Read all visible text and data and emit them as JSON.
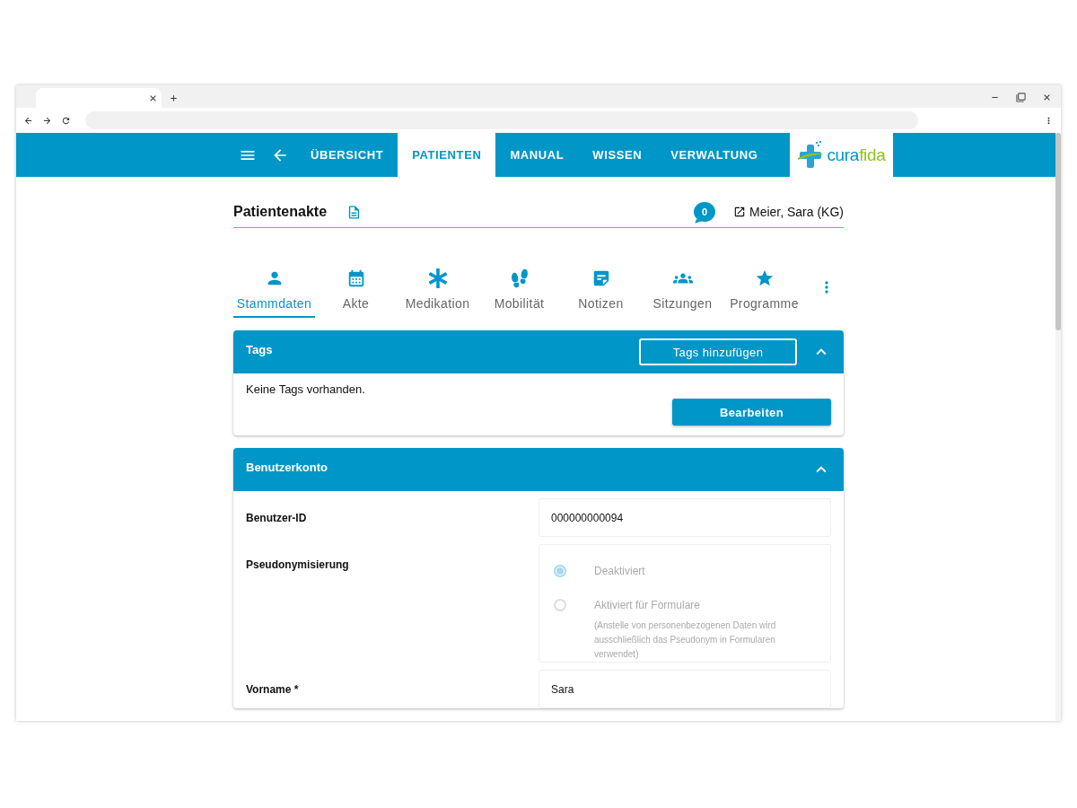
{
  "nav": {
    "items": [
      {
        "label": "ÜBERSICHT",
        "selected": false
      },
      {
        "label": "PATIENTEN",
        "selected": true
      },
      {
        "label": "MANUAL",
        "selected": false
      },
      {
        "label": "WISSEN",
        "selected": false
      },
      {
        "label": "VERWALTUNG",
        "selected": false
      }
    ],
    "logo": {
      "part1": "cura",
      "part2": "fida"
    }
  },
  "record": {
    "title": "Patientenakte",
    "badge": "0",
    "patient": "Meier, Sara (KG)"
  },
  "tabs": [
    {
      "label": "Stammdaten",
      "selected": true
    },
    {
      "label": "Akte",
      "selected": false
    },
    {
      "label": "Medikation",
      "selected": false
    },
    {
      "label": "Mobilität",
      "selected": false
    },
    {
      "label": "Notizen",
      "selected": false
    },
    {
      "label": "Sitzungen",
      "selected": false
    },
    {
      "label": "Programme",
      "selected": false
    }
  ],
  "tags_panel": {
    "title": "Tags",
    "add_button": "Tags hinzufügen",
    "expanded": true,
    "empty_text": "Keine Tags vorhanden.",
    "edit_button": "Bearbeiten"
  },
  "account_panel": {
    "title": "Benutzerkonto",
    "expanded": true,
    "fields": [
      {
        "kind": "text",
        "label": "Benutzer-ID",
        "value": "000000000094"
      },
      {
        "kind": "radio",
        "label": "Pseudonymisierung",
        "disabled": true,
        "options": [
          {
            "label": "Deaktiviert",
            "selected": true
          },
          {
            "label": "Aktiviert für Formulare",
            "selected": false,
            "note": "(Anstelle von personenbezogenen Daten wird ausschließlich das Pseudonym in Formularen verwendet)"
          }
        ]
      },
      {
        "kind": "text",
        "label": "Vorname *",
        "value": "Sara"
      }
    ]
  }
}
